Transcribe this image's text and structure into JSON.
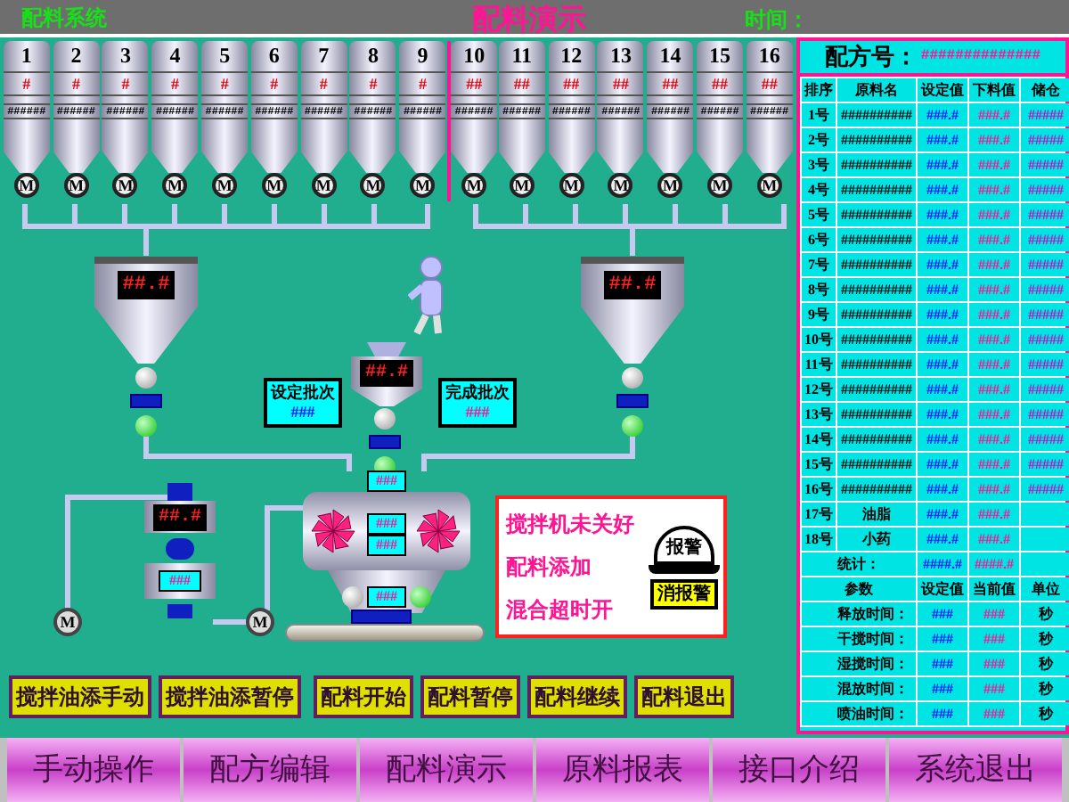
{
  "header": {
    "system": "配料系统",
    "title": "配料演示",
    "time_label": "时间："
  },
  "silos": [
    {
      "number": "1",
      "code": "#",
      "reading": "######",
      "motor": "M"
    },
    {
      "number": "2",
      "code": "#",
      "reading": "######",
      "motor": "M"
    },
    {
      "number": "3",
      "code": "#",
      "reading": "######",
      "motor": "M"
    },
    {
      "number": "4",
      "code": "#",
      "reading": "######",
      "motor": "M"
    },
    {
      "number": "5",
      "code": "#",
      "reading": "######",
      "motor": "M"
    },
    {
      "number": "6",
      "code": "#",
      "reading": "######",
      "motor": "M"
    },
    {
      "number": "7",
      "code": "#",
      "reading": "######",
      "motor": "M"
    },
    {
      "number": "8",
      "code": "#",
      "reading": "######",
      "motor": "M"
    },
    {
      "number": "9",
      "code": "#",
      "reading": "######",
      "motor": "M"
    },
    {
      "number": "10",
      "code": "##",
      "reading": "######",
      "motor": "M"
    },
    {
      "number": "11",
      "code": "##",
      "reading": "######",
      "motor": "M"
    },
    {
      "number": "12",
      "code": "##",
      "reading": "######",
      "motor": "M"
    },
    {
      "number": "13",
      "code": "##",
      "reading": "######",
      "motor": "M"
    },
    {
      "number": "14",
      "code": "##",
      "reading": "######",
      "motor": "M"
    },
    {
      "number": "15",
      "code": "##",
      "reading": "######",
      "motor": "M"
    },
    {
      "number": "16",
      "code": "##",
      "reading": "######",
      "motor": "M"
    }
  ],
  "diagram": {
    "left_hopper": "##.#",
    "right_hopper": "##.#",
    "small_hopper": "##.#",
    "set_batch": {
      "label": "设定批次",
      "value": "###"
    },
    "done_batch": {
      "label": "完成批次",
      "value": "###"
    },
    "mixer_readings": [
      "###",
      "###",
      "###",
      "###"
    ],
    "oil_tank": {
      "top": "##.#",
      "bottom": "###"
    },
    "pumps": [
      "M",
      "M"
    ]
  },
  "alarm": {
    "messages": [
      "搅拌机未关好",
      "配料添加",
      "混合超时开"
    ],
    "lamp": "报警",
    "reset_button": "消报警"
  },
  "recipe": {
    "label": "配方号：",
    "value": "##############",
    "columns": [
      "排序",
      "原料名",
      "设定值",
      "下料值",
      "储仓"
    ],
    "rows": [
      {
        "index": "1号",
        "name": "##########",
        "set": "###.#",
        "actual": "###.#",
        "bin": "#####"
      },
      {
        "index": "2号",
        "name": "##########",
        "set": "###.#",
        "actual": "###.#",
        "bin": "#####"
      },
      {
        "index": "3号",
        "name": "##########",
        "set": "###.#",
        "actual": "###.#",
        "bin": "#####"
      },
      {
        "index": "4号",
        "name": "##########",
        "set": "###.#",
        "actual": "###.#",
        "bin": "#####"
      },
      {
        "index": "5号",
        "name": "##########",
        "set": "###.#",
        "actual": "###.#",
        "bin": "#####"
      },
      {
        "index": "6号",
        "name": "##########",
        "set": "###.#",
        "actual": "###.#",
        "bin": "#####"
      },
      {
        "index": "7号",
        "name": "##########",
        "set": "###.#",
        "actual": "###.#",
        "bin": "#####"
      },
      {
        "index": "8号",
        "name": "##########",
        "set": "###.#",
        "actual": "###.#",
        "bin": "#####"
      },
      {
        "index": "9号",
        "name": "##########",
        "set": "###.#",
        "actual": "###.#",
        "bin": "#####"
      },
      {
        "index": "10号",
        "name": "##########",
        "set": "###.#",
        "actual": "###.#",
        "bin": "#####"
      },
      {
        "index": "11号",
        "name": "##########",
        "set": "###.#",
        "actual": "###.#",
        "bin": "#####"
      },
      {
        "index": "12号",
        "name": "##########",
        "set": "###.#",
        "actual": "###.#",
        "bin": "#####"
      },
      {
        "index": "13号",
        "name": "##########",
        "set": "###.#",
        "actual": "###.#",
        "bin": "#####"
      },
      {
        "index": "14号",
        "name": "##########",
        "set": "###.#",
        "actual": "###.#",
        "bin": "#####"
      },
      {
        "index": "15号",
        "name": "##########",
        "set": "###.#",
        "actual": "###.#",
        "bin": "#####"
      },
      {
        "index": "16号",
        "name": "##########",
        "set": "###.#",
        "actual": "###.#",
        "bin": "#####"
      },
      {
        "index": "17号",
        "name": "油脂",
        "set": "###.#",
        "actual": "###.#"
      },
      {
        "index": "18号",
        "name": "小药",
        "set": "###.#",
        "actual": "###.#"
      }
    ],
    "total": {
      "label": "统计：",
      "set": "####.#",
      "actual": "####.#"
    },
    "param_columns": [
      "参数",
      "设定值",
      "当前值",
      "单位"
    ],
    "params": [
      {
        "name": "释放时间：",
        "set": "###",
        "current": "###",
        "unit": "秒"
      },
      {
        "name": "干搅时间：",
        "set": "###",
        "current": "###",
        "unit": "秒"
      },
      {
        "name": "湿搅时间：",
        "set": "###",
        "current": "###",
        "unit": "秒"
      },
      {
        "name": "混放时间：",
        "set": "###",
        "current": "###",
        "unit": "秒"
      },
      {
        "name": "喷油时间：",
        "set": "###",
        "current": "###",
        "unit": "秒"
      }
    ]
  },
  "actions": [
    "搅拌油添手动",
    "搅拌油添暂停",
    "配料开始",
    "配料暂停",
    "配料继续",
    "配料退出"
  ],
  "nav": [
    "手动操作",
    "配方编辑",
    "配料演示",
    "原料报表",
    "接口介绍",
    "系统退出"
  ]
}
